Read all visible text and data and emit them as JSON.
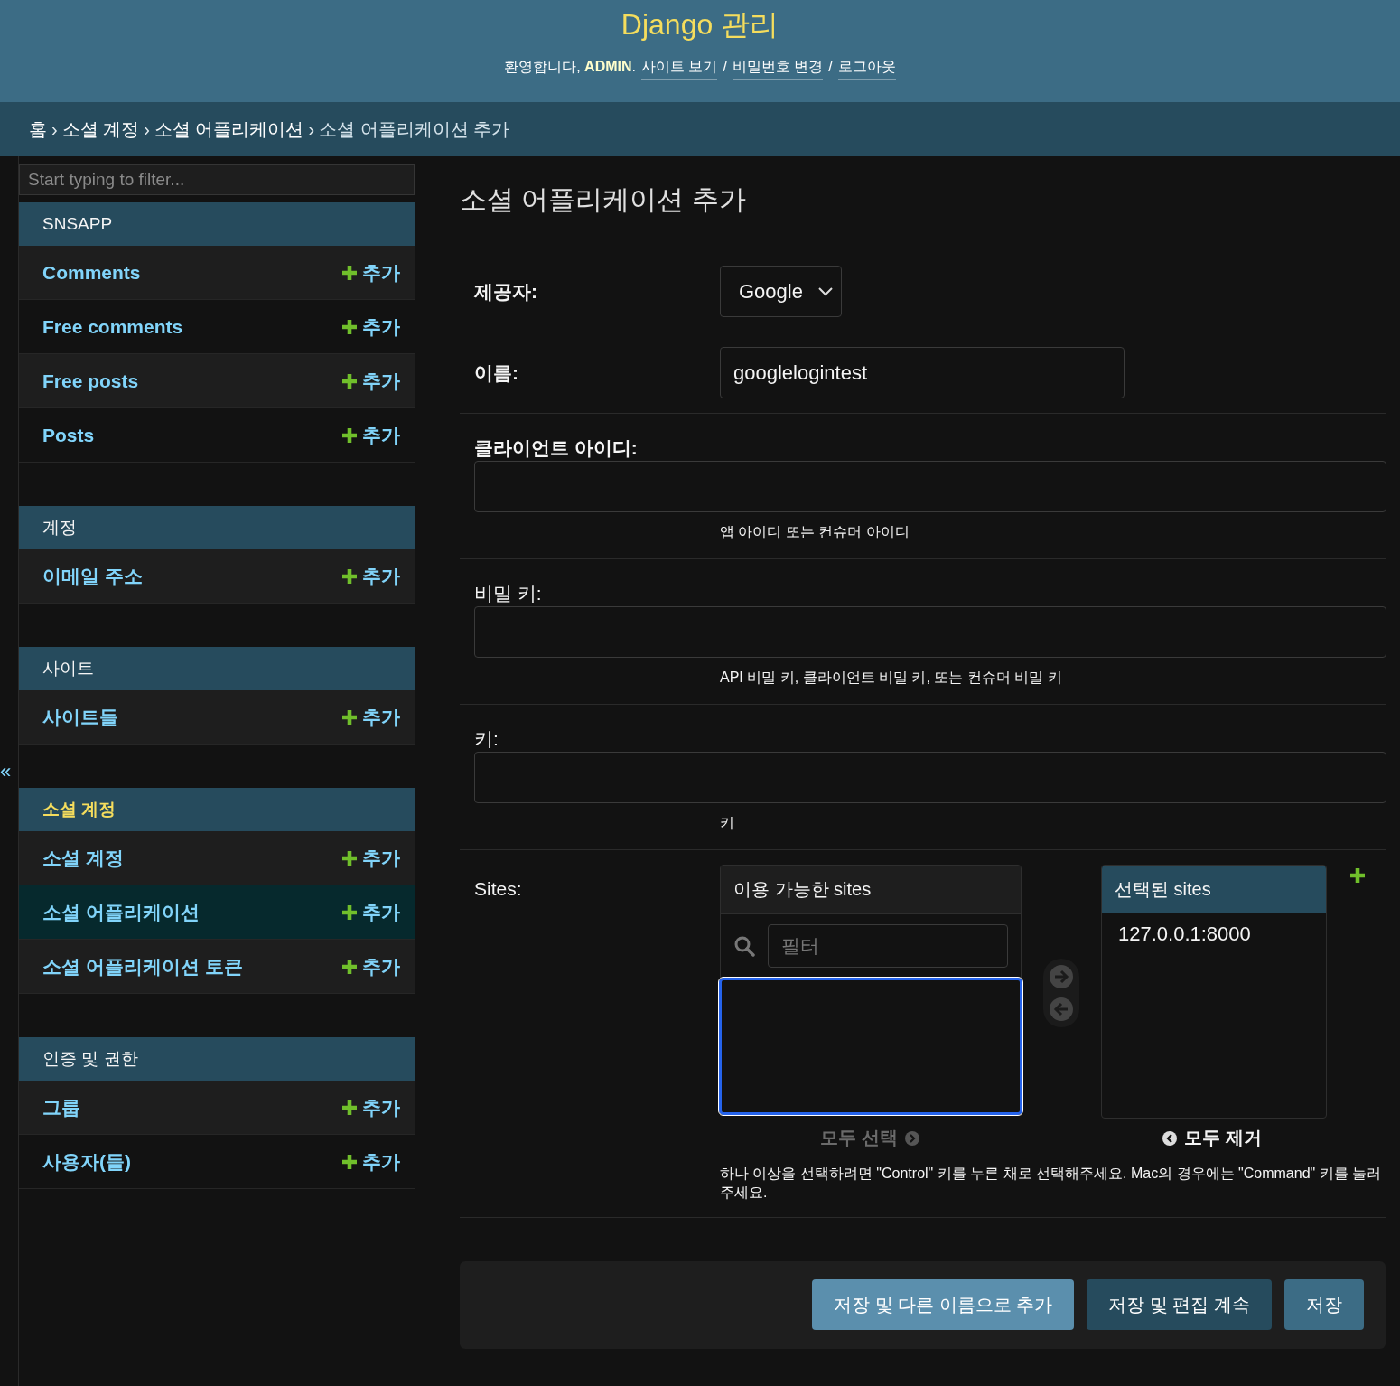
{
  "header": {
    "title": "Django 관리",
    "user_tools": [
      {
        "kind": "text",
        "text": "환영합니다, **ADMIN**."
      },
      {
        "kind": "link",
        "text": "사이트 보기"
      },
      {
        "kind": "separator",
        "text": "/"
      },
      {
        "kind": "link",
        "text": "비밀번호 변경"
      },
      {
        "kind": "separator",
        "text": "/"
      },
      {
        "kind": "link",
        "text": "로그아웃"
      }
    ]
  },
  "breadcrumbs": [
    {
      "kind": "link",
      "text": "홈"
    },
    {
      "kind": "separator",
      "text": "›"
    },
    {
      "kind": "link",
      "text": "소셜 계정"
    },
    {
      "kind": "separator",
      "text": "›"
    },
    {
      "kind": "link",
      "text": "소셜 어플리케이션"
    },
    {
      "kind": "separator",
      "text": "›"
    },
    {
      "kind": "current",
      "text": "소셜 어플리케이션 추가"
    }
  ],
  "sidebar": {
    "filter_placeholder": "Start typing to filter...",
    "toggle": "«",
    "modules": [
      {
        "caption": "SNSAPP",
        "current": false,
        "models": [
          {
            "name": "Comments",
            "add": "추가",
            "selected": false
          },
          {
            "name": "Free comments",
            "add": "추가",
            "selected": false
          },
          {
            "name": "Free posts",
            "add": "추가",
            "selected": false
          },
          {
            "name": "Posts",
            "add": "추가",
            "selected": false
          }
        ]
      },
      {
        "caption": "계정",
        "current": false,
        "models": [
          {
            "name": "이메일 주소",
            "add": "추가",
            "selected": false
          }
        ]
      },
      {
        "caption": "사이트",
        "current": false,
        "models": [
          {
            "name": "사이트들",
            "add": "추가",
            "selected": false
          }
        ]
      },
      {
        "caption": "소셜 계정",
        "current": true,
        "models": [
          {
            "name": "소셜 계정",
            "add": "추가",
            "selected": false
          },
          {
            "name": "소셜 어플리케이션",
            "add": "추가",
            "selected": true
          },
          {
            "name": "소셜 어플리케이션 토큰",
            "add": "추가",
            "selected": false
          }
        ]
      },
      {
        "caption": "인증 및 권한",
        "current": false,
        "models": [
          {
            "name": "그룹",
            "add": "추가",
            "selected": false
          },
          {
            "name": "사용자(들)",
            "add": "추가",
            "selected": false
          }
        ]
      }
    ]
  },
  "content": {
    "title": "소셜 어플리케이션 추가",
    "fields": [
      {
        "kind": "select",
        "label": "제공자:",
        "required": true,
        "value": "Google"
      },
      {
        "kind": "text",
        "label": "이름:",
        "required": true,
        "value": "googlelogintest"
      },
      {
        "kind": "wide",
        "label": "클라이언트 아이디:",
        "required": true,
        "help": "앱 아이디 또는 컨슈머 아이디"
      },
      {
        "kind": "wide",
        "label": "비밀 키:",
        "required": false,
        "help": "API 비밀 키, 클라이언트 비밀 키, 또는 컨슈머 비밀 키"
      },
      {
        "kind": "wide",
        "label": "키:",
        "required": false,
        "help": "키"
      },
      {
        "kind": "selector",
        "label": "Sites:",
        "required": false,
        "available": {
          "title": "이용 가능한 sites",
          "filter_placeholder": "필터"
        },
        "chosen": {
          "title": "선택된 sites",
          "items": [
            "127.0.0.1:8000"
          ]
        },
        "choose_all": {
          "text": "모두 선택",
          "disabled": true
        },
        "remove_all": {
          "text": "모두 제거",
          "disabled": false
        },
        "help": "하나 이상을 선택하려면 \"Control\" 키를 누른 채로 선택해주세요. Mac의 경우에는 \"Command\" 키를 눌러주세요."
      }
    ],
    "buttons": [
      {
        "kind": "save_add",
        "text": "저장 및 다른 이름으로 추가"
      },
      {
        "kind": "save_continue",
        "text": "저장 및 편집 계속"
      },
      {
        "kind": "save",
        "text": "저장"
      }
    ]
  }
}
